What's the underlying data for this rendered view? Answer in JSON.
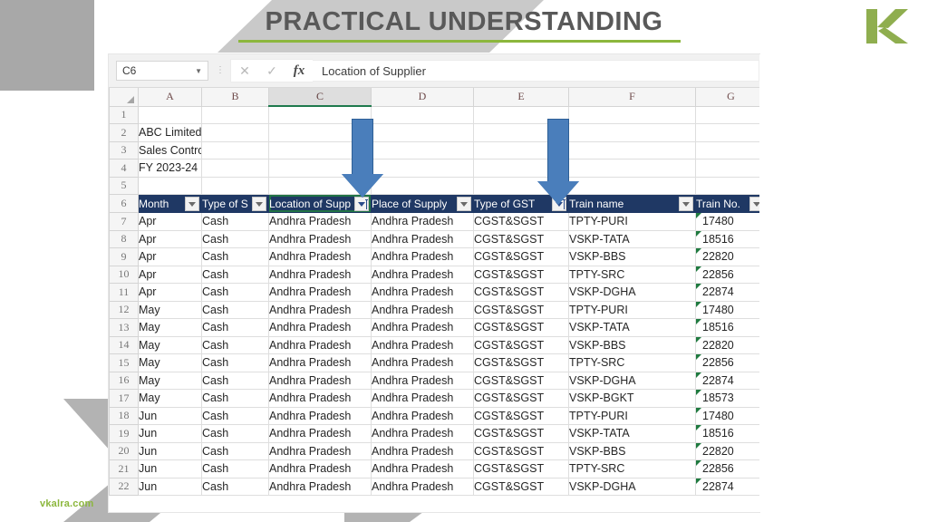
{
  "slide": {
    "title": "PRACTICAL UNDERSTANDING",
    "watermark": "vkalra.com",
    "logo_letter": "K",
    "accent_green": "#8cb73d",
    "title_color": "#595959"
  },
  "excel": {
    "name_box": "C6",
    "formula_bar_value": "Location of Supplier",
    "cancel_icon": "close-icon",
    "confirm_icon": "check-icon",
    "function_icon": "fx",
    "column_letters": [
      "A",
      "B",
      "C",
      "D",
      "E",
      "F",
      "G"
    ],
    "selected_column": "C",
    "selected_cell": "C6",
    "row_numbers": [
      "1",
      "2",
      "3",
      "4",
      "5",
      "6",
      "7",
      "8",
      "9",
      "10",
      "11",
      "12",
      "13",
      "14",
      "15",
      "16",
      "17",
      "18",
      "19",
      "20",
      "21",
      "22"
    ],
    "pre_rows": [
      {
        "row": "1",
        "a": ""
      },
      {
        "row": "2",
        "a": "ABC Limited"
      },
      {
        "row": "3",
        "a": "Sales Control Sheet"
      },
      {
        "row": "4",
        "a": "FY 2023-24"
      },
      {
        "row": "5",
        "a": ""
      }
    ],
    "table_headers": [
      {
        "label": "Month",
        "filter": "dropdown"
      },
      {
        "label": "Type of Sa",
        "filter": "dropdown"
      },
      {
        "label": "Location of Suppli",
        "filter": "sorted"
      },
      {
        "label": "Place of Supply",
        "filter": "dropdown"
      },
      {
        "label": "Type of GST",
        "filter": "sorted"
      },
      {
        "label": "Train name",
        "filter": "dropdown"
      },
      {
        "label": "Train No.",
        "filter": "dropdown"
      }
    ],
    "rows": [
      {
        "row": "7",
        "month": "Apr",
        "type_of_sale": "Cash",
        "location_of_supplier": "Andhra Pradesh",
        "place_of_supply": "Andhra Pradesh",
        "type_of_gst": "CGST&SGST",
        "train_name": "TPTY-PURI",
        "train_no": "17480"
      },
      {
        "row": "8",
        "month": "Apr",
        "type_of_sale": "Cash",
        "location_of_supplier": "Andhra Pradesh",
        "place_of_supply": "Andhra Pradesh",
        "type_of_gst": "CGST&SGST",
        "train_name": "VSKP-TATA",
        "train_no": "18516"
      },
      {
        "row": "9",
        "month": "Apr",
        "type_of_sale": "Cash",
        "location_of_supplier": "Andhra Pradesh",
        "place_of_supply": "Andhra Pradesh",
        "type_of_gst": "CGST&SGST",
        "train_name": "VSKP-BBS",
        "train_no": "22820"
      },
      {
        "row": "10",
        "month": "Apr",
        "type_of_sale": "Cash",
        "location_of_supplier": "Andhra Pradesh",
        "place_of_supply": "Andhra Pradesh",
        "type_of_gst": "CGST&SGST",
        "train_name": "TPTY-SRC",
        "train_no": "22856"
      },
      {
        "row": "11",
        "month": "Apr",
        "type_of_sale": "Cash",
        "location_of_supplier": "Andhra Pradesh",
        "place_of_supply": "Andhra Pradesh",
        "type_of_gst": "CGST&SGST",
        "train_name": "VSKP-DGHA",
        "train_no": "22874"
      },
      {
        "row": "12",
        "month": "May",
        "type_of_sale": "Cash",
        "location_of_supplier": "Andhra Pradesh",
        "place_of_supply": "Andhra Pradesh",
        "type_of_gst": "CGST&SGST",
        "train_name": "TPTY-PURI",
        "train_no": "17480"
      },
      {
        "row": "13",
        "month": "May",
        "type_of_sale": "Cash",
        "location_of_supplier": "Andhra Pradesh",
        "place_of_supply": "Andhra Pradesh",
        "type_of_gst": "CGST&SGST",
        "train_name": "VSKP-TATA",
        "train_no": "18516"
      },
      {
        "row": "14",
        "month": "May",
        "type_of_sale": "Cash",
        "location_of_supplier": "Andhra Pradesh",
        "place_of_supply": "Andhra Pradesh",
        "type_of_gst": "CGST&SGST",
        "train_name": "VSKP-BBS",
        "train_no": "22820"
      },
      {
        "row": "15",
        "month": "May",
        "type_of_sale": "Cash",
        "location_of_supplier": "Andhra Pradesh",
        "place_of_supply": "Andhra Pradesh",
        "type_of_gst": "CGST&SGST",
        "train_name": "TPTY-SRC",
        "train_no": "22856"
      },
      {
        "row": "16",
        "month": "May",
        "type_of_sale": "Cash",
        "location_of_supplier": "Andhra Pradesh",
        "place_of_supply": "Andhra Pradesh",
        "type_of_gst": "CGST&SGST",
        "train_name": "VSKP-DGHA",
        "train_no": "22874"
      },
      {
        "row": "17",
        "month": "May",
        "type_of_sale": "Cash",
        "location_of_supplier": "Andhra Pradesh",
        "place_of_supply": "Andhra Pradesh",
        "type_of_gst": "CGST&SGST",
        "train_name": "VSKP-BGKT",
        "train_no": "18573"
      },
      {
        "row": "18",
        "month": "Jun",
        "type_of_sale": "Cash",
        "location_of_supplier": "Andhra Pradesh",
        "place_of_supply": "Andhra Pradesh",
        "type_of_gst": "CGST&SGST",
        "train_name": "TPTY-PURI",
        "train_no": "17480"
      },
      {
        "row": "19",
        "month": "Jun",
        "type_of_sale": "Cash",
        "location_of_supplier": "Andhra Pradesh",
        "place_of_supply": "Andhra Pradesh",
        "type_of_gst": "CGST&SGST",
        "train_name": "VSKP-TATA",
        "train_no": "18516"
      },
      {
        "row": "20",
        "month": "Jun",
        "type_of_sale": "Cash",
        "location_of_supplier": "Andhra Pradesh",
        "place_of_supply": "Andhra Pradesh",
        "type_of_gst": "CGST&SGST",
        "train_name": "VSKP-BBS",
        "train_no": "22820"
      },
      {
        "row": "21",
        "month": "Jun",
        "type_of_sale": "Cash",
        "location_of_supplier": "Andhra Pradesh",
        "place_of_supply": "Andhra Pradesh",
        "type_of_gst": "CGST&SGST",
        "train_name": "TPTY-SRC",
        "train_no": "22856"
      },
      {
        "row": "22",
        "month": "Jun",
        "type_of_sale": "Cash",
        "location_of_supplier": "Andhra Pradesh",
        "place_of_supply": "Andhra Pradesh",
        "type_of_gst": "CGST&SGST",
        "train_name": "VSKP-DGHA",
        "train_no": "22874"
      }
    ],
    "header_fill": "#1f3864",
    "selection_color": "#217346"
  },
  "annotations": [
    {
      "id": "arrow-supplier",
      "target": "Location of Supplier filter button",
      "color": "#4a7ebb"
    },
    {
      "id": "arrow-gst",
      "target": "Type of GST filter button",
      "color": "#4a7ebb"
    }
  ]
}
